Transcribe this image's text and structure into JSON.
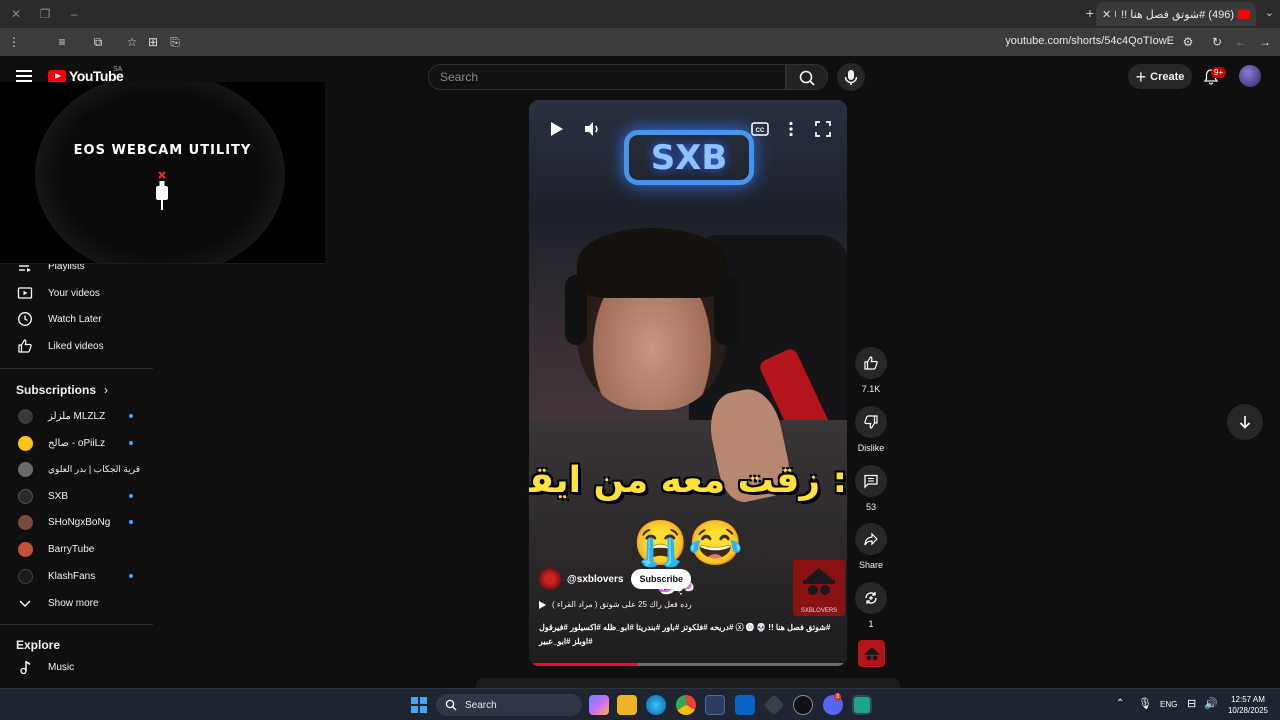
{
  "browser": {
    "tab_title": "(496) #شوتق فصل هنا !! 💀 ⓧ 🅓",
    "url": "youtube.com/shorts/54c4QoTIowE",
    "new_tab_symbol": "+",
    "tab_close_symbol": "✕"
  },
  "header": {
    "logo_text": "YouTube",
    "country_code": "SA",
    "search_placeholder": "Search",
    "create_label": "Create",
    "notification_count": "9+"
  },
  "webcam": {
    "title": "EOS WEBCAM UTILITY"
  },
  "sidebar": {
    "you_items": [
      {
        "label": "Playlists",
        "icon": "playlist-icon"
      },
      {
        "label": "Your videos",
        "icon": "your-videos-icon"
      },
      {
        "label": "Watch Later",
        "icon": "clock-icon"
      },
      {
        "label": "Liked videos",
        "icon": "thumbs-up-icon"
      }
    ],
    "subscriptions_title": "Subscriptions",
    "subscriptions": [
      {
        "name": "ملزلز MLZLZ",
        "color": "#3a3a3a",
        "new": true
      },
      {
        "name": "صالح - oPiiLz",
        "color": "#f5c518",
        "new": true
      },
      {
        "name": "قرية الجكاب | بدر العلوي",
        "color": "#6a6a6a",
        "new": false
      },
      {
        "name": "SXB",
        "color": "#2a2a2a",
        "new": true
      },
      {
        "name": "SHoNgxBoNg",
        "color": "#7a4a3a",
        "new": true
      },
      {
        "name": "BarryTube",
        "color": "#c0503a",
        "new": false
      },
      {
        "name": "KlashFans",
        "color": "#1a1a1a",
        "new": true
      }
    ],
    "show_more_label": "Show more",
    "explore_title": "Explore",
    "explore_items": [
      {
        "label": "Music",
        "icon": "music-note-icon"
      }
    ]
  },
  "short": {
    "led_sign": "SXB",
    "caption": ": زقت معه من ايقل",
    "emojis": "😭😂",
    "overlay_text": "دبل",
    "channel_handle": "@sxblovers",
    "subscribe_label": "Subscribe",
    "logo_box_text": "SXBLOVERS",
    "music_text": "رده فعل راك 25 على شوتق ( مراد القراء )",
    "description": "#شوتق فصل هنا !! 💀 ⓧ 🅓 #دريحه #فلكوتز #باور #بندريتا #ابو_ظله #اكسيلور #فيرقول #اوبلز #ابو_عبير",
    "progress": 0.34
  },
  "actions": {
    "like_count": "7.1K",
    "dislike_label": "Dislike",
    "comment_count": "53",
    "share_label": "Share",
    "remix_count": "1"
  },
  "taskbar": {
    "search_label": "Search",
    "language": "ENG",
    "time": "12:57 AM",
    "date": "10/28/2025",
    "discord_badge": "3"
  },
  "colors": {
    "youtube_red": "#ff0000",
    "accent_blue": "#3ea6ff",
    "background": "#0f0f0f"
  }
}
